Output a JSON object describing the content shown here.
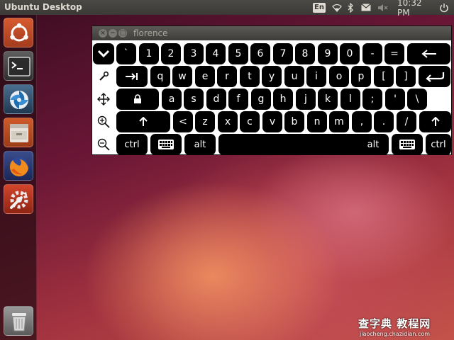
{
  "top_panel": {
    "title": "Ubuntu Desktop",
    "keyboard_layout": "En",
    "clock": "10:32 PM",
    "icons": [
      "keyboard-layout-icon",
      "wifi-icon",
      "bluetooth-icon",
      "mail-icon",
      "volume-muted-icon",
      "power-icon"
    ]
  },
  "launcher": {
    "items": [
      {
        "name": "dash-home",
        "icon": "ubuntu-logo-icon"
      },
      {
        "name": "terminal",
        "icon": "terminal-icon"
      },
      {
        "name": "shutter",
        "icon": "shutter-icon"
      },
      {
        "name": "files",
        "icon": "file-cabinet-icon"
      },
      {
        "name": "firefox",
        "icon": "firefox-icon"
      },
      {
        "name": "system-settings",
        "icon": "settings-icon"
      },
      {
        "name": "trash",
        "icon": "trash-icon"
      }
    ]
  },
  "florence": {
    "title": "florence",
    "rows": [
      [
        {
          "label": "",
          "icon": "chevron-down-icon"
        },
        {
          "label": "`"
        },
        {
          "label": "1"
        },
        {
          "label": "2"
        },
        {
          "label": "3"
        },
        {
          "label": "4"
        },
        {
          "label": "5"
        },
        {
          "label": "6"
        },
        {
          "label": "7"
        },
        {
          "label": "8"
        },
        {
          "label": "9"
        },
        {
          "label": "0"
        },
        {
          "label": "-"
        },
        {
          "label": "="
        },
        {
          "label": "",
          "icon": "backspace-arrow-icon"
        }
      ],
      [
        {
          "label": "",
          "icon": "wrench-icon"
        },
        {
          "label": "",
          "icon": "tab-icon"
        },
        {
          "label": "q"
        },
        {
          "label": "w"
        },
        {
          "label": "e"
        },
        {
          "label": "r"
        },
        {
          "label": "t"
        },
        {
          "label": "y"
        },
        {
          "label": "u"
        },
        {
          "label": "i"
        },
        {
          "label": "o"
        },
        {
          "label": "p"
        },
        {
          "label": "["
        },
        {
          "label": "]"
        },
        {
          "label": "",
          "icon": "return-icon"
        }
      ],
      [
        {
          "label": "",
          "icon": "move-icon"
        },
        {
          "label": "",
          "icon": "caps-lock-icon"
        },
        {
          "label": "a"
        },
        {
          "label": "s"
        },
        {
          "label": "d"
        },
        {
          "label": "f"
        },
        {
          "label": "g"
        },
        {
          "label": "h"
        },
        {
          "label": "j"
        },
        {
          "label": "k"
        },
        {
          "label": "l"
        },
        {
          "label": ";"
        },
        {
          "label": "'"
        },
        {
          "label": "\\"
        }
      ],
      [
        {
          "label": "",
          "icon": "zoom-in-icon"
        },
        {
          "label": "",
          "icon": "shift-left-icon"
        },
        {
          "label": "<"
        },
        {
          "label": "z"
        },
        {
          "label": "x"
        },
        {
          "label": "c"
        },
        {
          "label": "v"
        },
        {
          "label": "b"
        },
        {
          "label": "n"
        },
        {
          "label": "m"
        },
        {
          "label": ","
        },
        {
          "label": "."
        },
        {
          "label": "/"
        },
        {
          "label": "",
          "icon": "shift-right-icon"
        }
      ],
      [
        {
          "label": "",
          "icon": "zoom-out-icon"
        },
        {
          "label": "ctrl"
        },
        {
          "label": "",
          "icon": "keyboard-icon"
        },
        {
          "label": "alt"
        },
        {
          "label": "",
          "icon": "space-bar"
        },
        {
          "label": "alt"
        },
        {
          "label": "",
          "icon": "keyboard-icon"
        },
        {
          "label": "ctrl"
        }
      ]
    ]
  },
  "watermark": {
    "main": "查字典 教程网",
    "sub": "jiaocheng.chazidian.com"
  }
}
